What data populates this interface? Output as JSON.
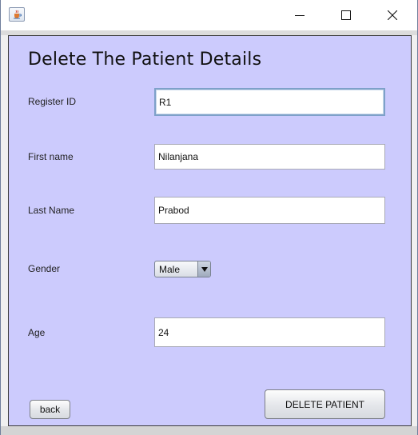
{
  "window": {
    "app_icon": "java-cup-icon",
    "controls": [
      "minimize-icon",
      "maximize-icon",
      "close-icon"
    ]
  },
  "form": {
    "heading": "Delete The Patient Details",
    "register_id": {
      "label": "Register ID",
      "value": "R1"
    },
    "first_name": {
      "label": "First name",
      "value": "Nilanjana"
    },
    "last_name": {
      "label": "Last Name",
      "value": "Prabod"
    },
    "gender": {
      "label": "Gender",
      "selected": "Male"
    },
    "age": {
      "label": "Age",
      "value": "24"
    }
  },
  "buttons": {
    "back": "back",
    "delete": "DELETE PATIENT"
  },
  "colors": {
    "panel_background": "#cccbfd",
    "focus_border": "#7ea1c9"
  }
}
